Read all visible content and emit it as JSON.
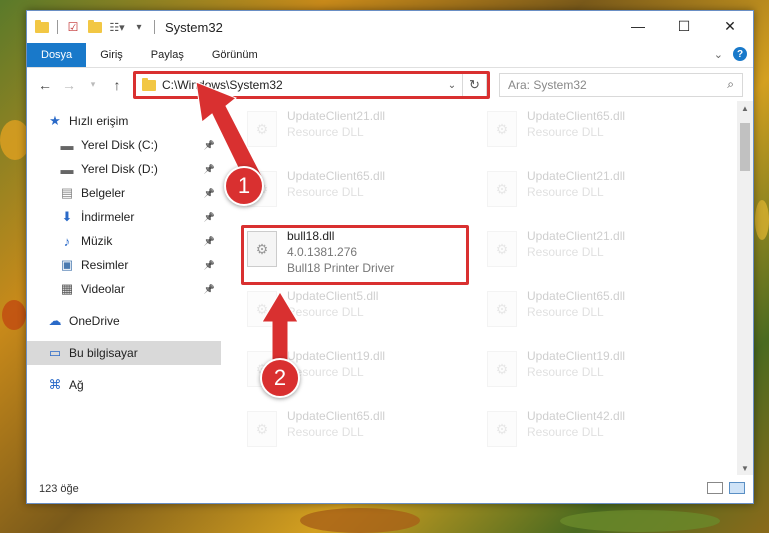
{
  "window": {
    "title": "System32",
    "controls": {
      "minimize": "—",
      "maximize": "☐",
      "close": "✕"
    }
  },
  "ribbon": {
    "tabs": [
      "Dosya",
      "Giriş",
      "Paylaş",
      "Görünüm"
    ]
  },
  "navigation": {
    "address": "C:\\Windows\\System32",
    "search_placeholder": "Ara: System32"
  },
  "sidebar": {
    "items": [
      {
        "label": "Hızlı erişim",
        "icon": "star-icon",
        "pinned": false
      },
      {
        "label": "Yerel Disk (C:)",
        "icon": "drive-icon",
        "pinned": true
      },
      {
        "label": "Yerel Disk (D:)",
        "icon": "drive-icon",
        "pinned": true
      },
      {
        "label": "Belgeler",
        "icon": "document-icon",
        "pinned": true
      },
      {
        "label": "İndirmeler",
        "icon": "download-icon",
        "pinned": true
      },
      {
        "label": "Müzik",
        "icon": "music-icon",
        "pinned": true
      },
      {
        "label": "Resimler",
        "icon": "picture-icon",
        "pinned": true
      },
      {
        "label": "Videolar",
        "icon": "video-icon",
        "pinned": true
      },
      {
        "label": "OneDrive",
        "icon": "cloud-icon",
        "pinned": false
      },
      {
        "label": "Bu bilgisayar",
        "icon": "computer-icon",
        "pinned": false
      },
      {
        "label": "Ağ",
        "icon": "network-icon",
        "pinned": false
      }
    ]
  },
  "files": {
    "left_column": [
      {
        "name": "UpdateClient21.dll",
        "sub": "Resource DLL"
      },
      {
        "name": "UpdateClient65.dll",
        "sub": "Resource DLL"
      },
      {
        "name": "bull18.dll",
        "version": "4.0.1381.276",
        "sub": "Bull18 Printer Driver"
      },
      {
        "name": "UpdateClient5.dll",
        "sub": "Resource DLL"
      },
      {
        "name": "UpdateClient19.dll",
        "sub": "Resource DLL"
      },
      {
        "name": "UpdateClient65.dll",
        "sub": "Resource DLL"
      }
    ],
    "right_column": [
      {
        "name": "UpdateClient65.dll",
        "sub": "Resource DLL"
      },
      {
        "name": "UpdateClient21.dll",
        "sub": "Resource DLL"
      },
      {
        "name": "UpdateClient21.dll",
        "sub": "Resource DLL"
      },
      {
        "name": "UpdateClient65.dll",
        "sub": "Resource DLL"
      },
      {
        "name": "UpdateClient19.dll",
        "sub": "Resource DLL"
      },
      {
        "name": "UpdateClient42.dll",
        "sub": "Resource DLL"
      }
    ]
  },
  "status": {
    "count": "123 öğe"
  },
  "annotations": {
    "badge1": "1",
    "badge2": "2",
    "color": "#d93030"
  }
}
